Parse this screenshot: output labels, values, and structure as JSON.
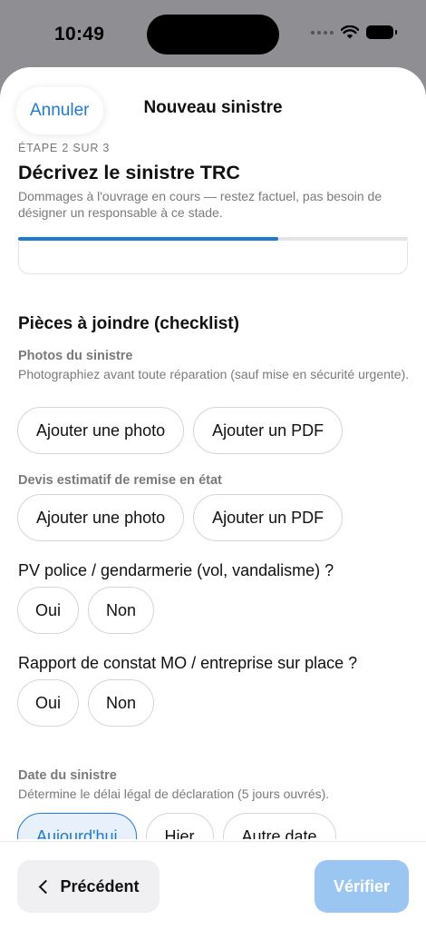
{
  "status_bar": {
    "time": "10:49",
    "icons": [
      "signal-dots-icon",
      "wifi-icon",
      "battery-icon"
    ]
  },
  "nav": {
    "cancel_label": "Annuler",
    "title": "Nouveau sinistre"
  },
  "step": {
    "label": "ÉTAPE 2 SUR 3",
    "title": "Décrivez le sinistre TRC",
    "description": "Dommages à l'ouvrage en cours — restez factuel, pas besoin de désigner un responsable à ce stade.",
    "progress_fraction": 0.667
  },
  "attachments": {
    "section_title": "Pièces à joindre (checklist)",
    "photos": {
      "label": "Photos du sinistre",
      "hint": "Photographiez avant toute réparation (sauf mise en sécurité urgente).",
      "add_photo": "Ajouter une photo",
      "add_pdf": "Ajouter un PDF"
    },
    "estimate": {
      "label": "Devis estimatif de remise en état",
      "add_photo": "Ajouter une photo",
      "add_pdf": "Ajouter un PDF"
    }
  },
  "questions": [
    {
      "text": "PV police / gendarmerie (vol, vandalisme) ?",
      "yes": "Oui",
      "no": "Non"
    },
    {
      "text": "Rapport de constat MO / entreprise sur place ?",
      "yes": "Oui",
      "no": "Non"
    }
  ],
  "date": {
    "label": "Date du sinistre",
    "hint": "Détermine le délai légal de déclaration (5 jours ouvrés).",
    "options": [
      "Aujourd'hui",
      "Hier",
      "Autre date"
    ],
    "selected": "Aujourd'hui"
  },
  "footer": {
    "prev_label": "Précédent",
    "verify_label": "Vérifier"
  },
  "colors": {
    "accent": "#1f7ad6",
    "verify_disabled": "#9cc6f2",
    "backdrop": "#8e8e93"
  }
}
